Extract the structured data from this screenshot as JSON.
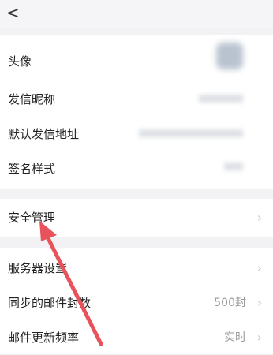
{
  "nav": {
    "back_glyph": "<"
  },
  "profile": {
    "avatar_label": "头像",
    "sender_name_label": "发信昵称",
    "default_address_label": "默认发信地址",
    "signature_label": "签名样式"
  },
  "security": {
    "label": "安全管理"
  },
  "server": {
    "server_settings_label": "服务器设置",
    "sync_count_label": "同步的邮件封数",
    "sync_count_value": "500封",
    "refresh_label": "邮件更新频率",
    "refresh_value": "实时"
  },
  "colors": {
    "annotation_arrow": "#e8525a",
    "background": "#f2f2f4"
  },
  "icons": [
    "back-icon",
    "chevron-right-icon"
  ]
}
